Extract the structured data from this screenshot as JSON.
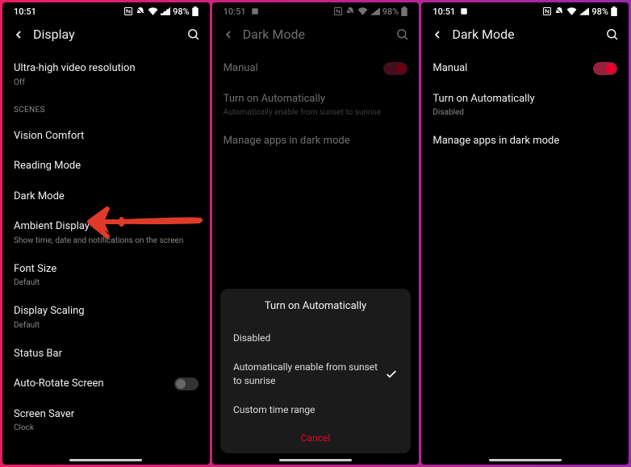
{
  "status": {
    "time": "10:51",
    "battery_pct": "98%",
    "icons": [
      "nfc-icon",
      "dnd-icon",
      "wifi-icon",
      "signal-icon",
      "battery-icon"
    ]
  },
  "accent_color": "#eb0029",
  "screen1": {
    "title": "Display",
    "item_ultra": {
      "label": "Ultra-high video resolution",
      "sub": "Off"
    },
    "section_scenes": "SCENES",
    "item_vision": {
      "label": "Vision Comfort"
    },
    "item_reading": {
      "label": "Reading Mode"
    },
    "item_darkmode": {
      "label": "Dark Mode"
    },
    "item_ambient": {
      "label": "Ambient Display",
      "sub": "Show time, date and notifications on the screen"
    },
    "item_font": {
      "label": "Font Size",
      "sub": "Default"
    },
    "item_scaling": {
      "label": "Display Scaling",
      "sub": "Default"
    },
    "item_statusbar": {
      "label": "Status Bar"
    },
    "item_autorotate": {
      "label": "Auto-Rotate Screen",
      "toggle": false
    },
    "item_screensaver": {
      "label": "Screen Saver",
      "sub": "Clock"
    }
  },
  "screen2": {
    "title": "Dark Mode",
    "item_manual": {
      "label": "Manual",
      "toggle": true
    },
    "item_auto": {
      "label": "Turn on Automatically",
      "sub": "Automatically enable from sunset to sunrise"
    },
    "item_manage": {
      "label": "Manage apps in dark mode"
    },
    "dialog": {
      "title": "Turn on Automatically",
      "opt_disabled": "Disabled",
      "opt_sunset": "Automatically enable from sunset to sunrise",
      "opt_custom": "Custom time range",
      "selected_index": 1,
      "cancel": "Cancel"
    }
  },
  "screen3": {
    "title": "Dark Mode",
    "item_manual": {
      "label": "Manual",
      "toggle": true
    },
    "item_auto": {
      "label": "Turn on Automatically",
      "sub": "Disabled"
    },
    "item_manage": {
      "label": "Manage apps in dark mode"
    }
  }
}
